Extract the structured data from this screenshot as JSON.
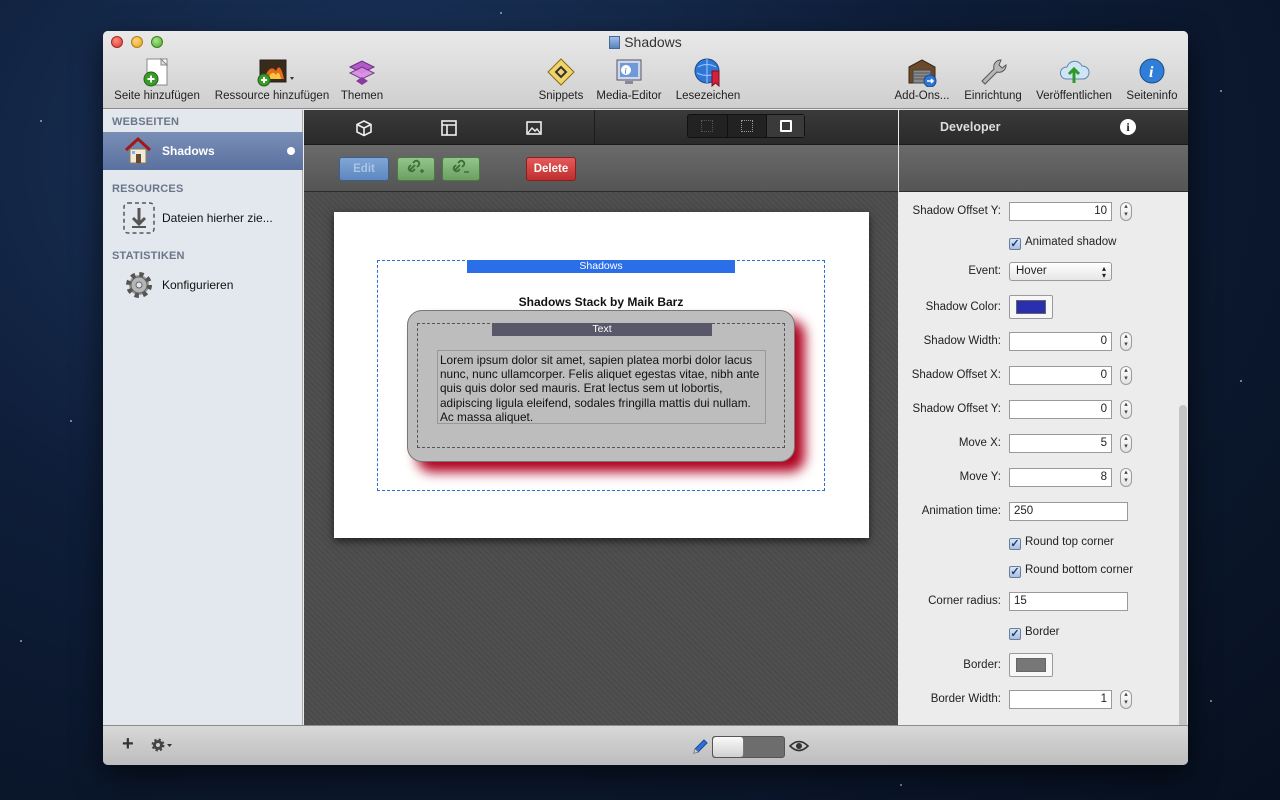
{
  "window": {
    "title": "Shadows"
  },
  "toolbar": {
    "left": [
      {
        "label": "Seite hinzufügen",
        "icon": "add-page-icon"
      },
      {
        "label": "Ressource hinzufügen",
        "icon": "add-resource-icon"
      },
      {
        "label": "Themen",
        "icon": "themes-icon"
      }
    ],
    "center": [
      {
        "label": "Snippets",
        "icon": "snippets-icon"
      },
      {
        "label": "Media-Editor",
        "icon": "media-editor-icon"
      },
      {
        "label": "Lesezeichen",
        "icon": "bookmarks-icon"
      }
    ],
    "right": [
      {
        "label": "Add-Ons...",
        "icon": "addons-icon"
      },
      {
        "label": "Einrichtung",
        "icon": "wrench-icon"
      },
      {
        "label": "Veröffentlichen",
        "icon": "publish-icon"
      },
      {
        "label": "Seiteninfo",
        "icon": "info-icon"
      }
    ]
  },
  "sidebar": {
    "sections": [
      {
        "header": "WEBSEITEN",
        "item": "Shadows",
        "icon": "house-icon",
        "selected": true
      },
      {
        "header": "RESOURCES",
        "item": "Dateien hierher zie...",
        "icon": "download-icon"
      },
      {
        "header": "STATISTIKEN",
        "item": "Konfigurieren",
        "icon": "gear-icon"
      }
    ]
  },
  "editor": {
    "buttons": {
      "edit": "Edit",
      "delete": "Delete"
    },
    "stack_tab": "Shadows",
    "stack_title": "Shadows Stack by Maik Barz",
    "text_tab": "Text",
    "lorem": "Lorem ipsum dolor sit amet, sapien platea morbi dolor lacus nunc, nunc ullamcorper. Felis aliquet egestas vitae, nibh ante quis quis dolor sed mauris. Erat lectus sem ut lobortis, adipiscing ligula eleifend, sodales fringilla mattis dui nullam. Ac massa aliquet."
  },
  "inspector": {
    "header": "Developer",
    "rows": {
      "shadow_offset_y_1": {
        "label": "Shadow Offset Y:",
        "value": "10"
      },
      "animated_shadow": {
        "label": "Animated shadow",
        "checked": true
      },
      "event": {
        "label": "Event:",
        "value": "Hover"
      },
      "shadow_color": {
        "label": "Shadow Color:",
        "color": "#2a2fb0"
      },
      "shadow_width": {
        "label": "Shadow Width:",
        "value": "0"
      },
      "shadow_offset_x": {
        "label": "Shadow Offset X:",
        "value": "0"
      },
      "shadow_offset_y_2": {
        "label": "Shadow Offset Y:",
        "value": "0"
      },
      "move_x": {
        "label": "Move X:",
        "value": "5"
      },
      "move_y": {
        "label": "Move Y:",
        "value": "8"
      },
      "animation_time": {
        "label": "Animation time:",
        "value": "250"
      },
      "round_top": {
        "label": "Round top corner",
        "checked": true
      },
      "round_bottom": {
        "label": "Round bottom corner",
        "checked": true
      },
      "corner_radius": {
        "label": "Corner radius:",
        "value": "15"
      },
      "border": {
        "label": "Border",
        "checked": true
      },
      "border_color": {
        "label": "Border:",
        "color": "#777777"
      },
      "border_width": {
        "label": "Border Width:",
        "value": "1"
      }
    }
  },
  "colors": {
    "accent_blue": "#2a6fe8",
    "delete_red": "#d63a3a",
    "shadow_red": "#b0001f"
  }
}
